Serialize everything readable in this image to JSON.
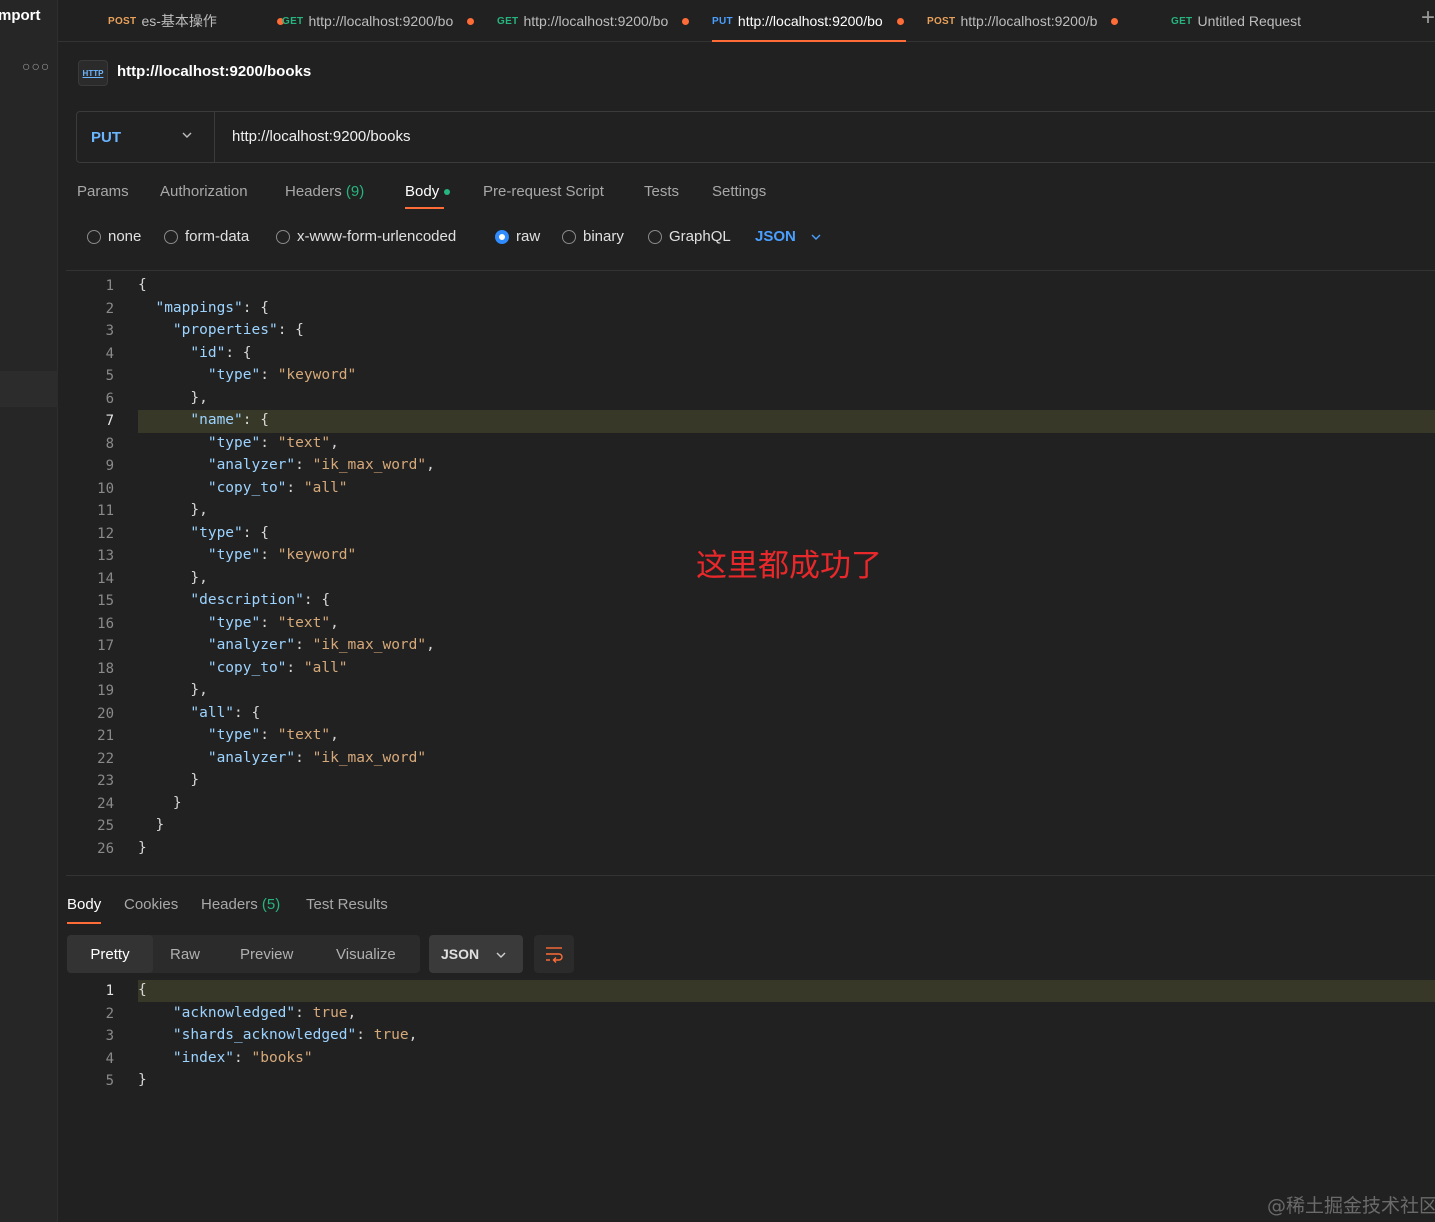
{
  "sidebar": {
    "import_label": "mport"
  },
  "tabs": [
    {
      "method": "POST",
      "title": "es-基本操作",
      "method_color": "#e9a15a"
    },
    {
      "method": "GET",
      "title": "http://localhost:9200/bo",
      "method_color": "#26b47f"
    },
    {
      "method": "GET",
      "title": "http://localhost:9200/bo",
      "method_color": "#26b47f"
    },
    {
      "method": "PUT",
      "title": "http://localhost:9200/bo",
      "method_color": "#4a9fff"
    },
    {
      "method": "POST",
      "title": "http://localhost:9200/b",
      "method_color": "#e9a15a"
    },
    {
      "method": "GET",
      "title": "Untitled Request",
      "method_color": "#26b47f"
    }
  ],
  "request": {
    "title": "http://localhost:9200/books",
    "method": "PUT",
    "url": "http://localhost:9200/books",
    "tabs": {
      "params": "Params",
      "authorization": "Authorization",
      "headers": "Headers",
      "headers_count": "(9)",
      "body": "Body",
      "pre_request": "Pre-request Script",
      "tests": "Tests",
      "settings": "Settings"
    },
    "body_types": {
      "none": "none",
      "form_data": "form-data",
      "urlencoded": "x-www-form-urlencoded",
      "raw": "raw",
      "binary": "binary",
      "graphql": "GraphQL"
    },
    "body_language": "JSON"
  },
  "editor_lines": [
    "{",
    "  \"mappings\": {",
    "    \"properties\": {",
    "      \"id\": {",
    "        \"type\": \"keyword\"",
    "      },",
    "      \"name\": {",
    "        \"type\": \"text\",",
    "        \"analyzer\": \"ik_max_word\",",
    "        \"copy_to\": \"all\"",
    "      },",
    "      \"type\": {",
    "        \"type\": \"keyword\"",
    "      },",
    "      \"description\": {",
    "        \"type\": \"text\",",
    "        \"analyzer\": \"ik_max_word\",",
    "        \"copy_to\": \"all\"",
    "      },",
    "      \"all\": {",
    "        \"type\": \"text\",",
    "        \"analyzer\": \"ik_max_word\"",
    "      }",
    "    }",
    "  }",
    "}"
  ],
  "annotation": "这里都成功了",
  "response": {
    "tabs": {
      "body": "Body",
      "cookies": "Cookies",
      "headers": "Headers",
      "headers_count": "(5)",
      "test_results": "Test Results"
    },
    "views": {
      "pretty": "Pretty",
      "raw": "Raw",
      "preview": "Preview",
      "visualize": "Visualize"
    },
    "format": "JSON",
    "lines": [
      "{",
      "    \"acknowledged\": true,",
      "    \"shards_acknowledged\": true,",
      "    \"index\": \"books\"",
      "}"
    ]
  },
  "watermark": "@稀土掘金技术社区",
  "colors": {
    "accent": "#ff6c37",
    "put": "#4a9fff",
    "success": "#26b47f",
    "annotation": "#e8282a"
  }
}
